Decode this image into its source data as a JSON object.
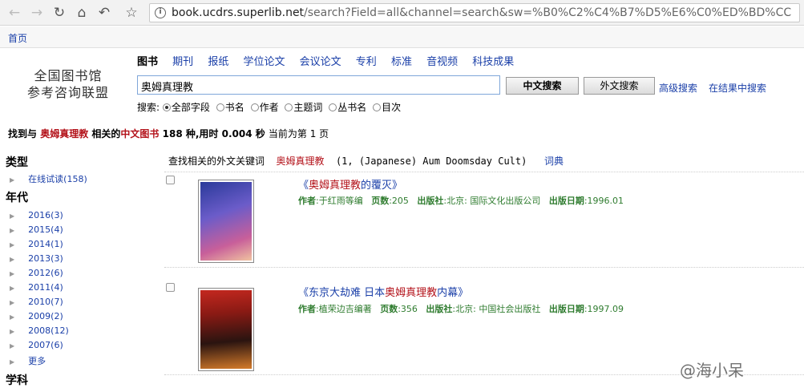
{
  "browser": {
    "url_host": "book.ucdrs.superlib.net",
    "url_path": "/search?Field=all&channel=search&sw=%B0%C2%C4%B7%D5%E6%C0%ED%BD%CC",
    "info_icon": "i"
  },
  "homebar": {
    "home_link": "首页"
  },
  "logo": {
    "line1": "全国图书馆",
    "line2": "参考咨询联盟"
  },
  "categories": [
    "图书",
    "期刊",
    "报纸",
    "学位论文",
    "会议论文",
    "专利",
    "标准",
    "音视频",
    "科技成果"
  ],
  "search": {
    "value": "奥姆真理教",
    "btn_chinese": "中文搜索",
    "btn_foreign": "外文搜索",
    "advanced": "高级搜索",
    "in_results": "在结果中搜索",
    "field_label": "搜索:",
    "fields": [
      "全部字段",
      "书名",
      "作者",
      "主题词",
      "丛书名",
      "目次"
    ]
  },
  "summary": {
    "p1": "找到与",
    "keyword": "奥姆真理教",
    "p2": "相关的",
    "type": "中文图书",
    "p3": "188 种,用时 0.004 秒",
    "p4": "当前为第 1 页"
  },
  "sidebar": {
    "type_head": "类型",
    "type_items": [
      "在线试读(158)"
    ],
    "year_head": "年代",
    "year_items": [
      "2016(3)",
      "2015(4)",
      "2014(1)",
      "2013(3)",
      "2012(6)",
      "2011(4)",
      "2010(7)",
      "2009(2)",
      "2008(12)",
      "2007(6)",
      "更多"
    ],
    "subject_head": "学科"
  },
  "related": {
    "label": "查找相关的外文关键词",
    "keyword": "奥姆真理教",
    "terms": "(1, (Japanese) Aum Doomsday Cult)",
    "dict": "词典"
  },
  "results": [
    {
      "title_prefix": "《",
      "title_keyword": "奥姆真理教",
      "title_rest": "的覆灭》",
      "author_label": "作者",
      "author": ":于红雨等编",
      "pages_label": "页数",
      "pages": ":205",
      "publisher_label": "出版社",
      "publisher": ":北京: 国际文化出版公司",
      "date_label": "出版日期",
      "date": ":1996.01"
    },
    {
      "title_prefix": "《东京大劫难 日本",
      "title_keyword": "奥姆真理教",
      "title_rest": "内幕》",
      "author_label": "作者",
      "author": ":植荣边吉编著",
      "pages_label": "页数",
      "pages": ":356",
      "publisher_label": "出版社",
      "publisher": ":北京: 中国社会出版社",
      "date_label": "出版日期",
      "date": ":1997.09"
    }
  ],
  "watermark": "@海小呆",
  "colors": {
    "link": "#1a3fa8",
    "highlight": "#b3121a",
    "meta": "#2f7c2f"
  }
}
